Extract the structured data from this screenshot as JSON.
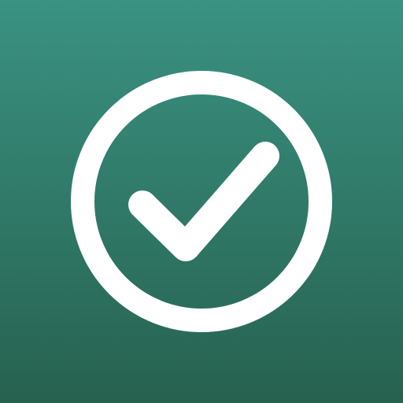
{
  "icon": {
    "name": "check-circle-icon",
    "colors": {
      "background_top": "#3a9282",
      "background_bottom": "#27614f",
      "foreground": "#ffffff"
    }
  }
}
